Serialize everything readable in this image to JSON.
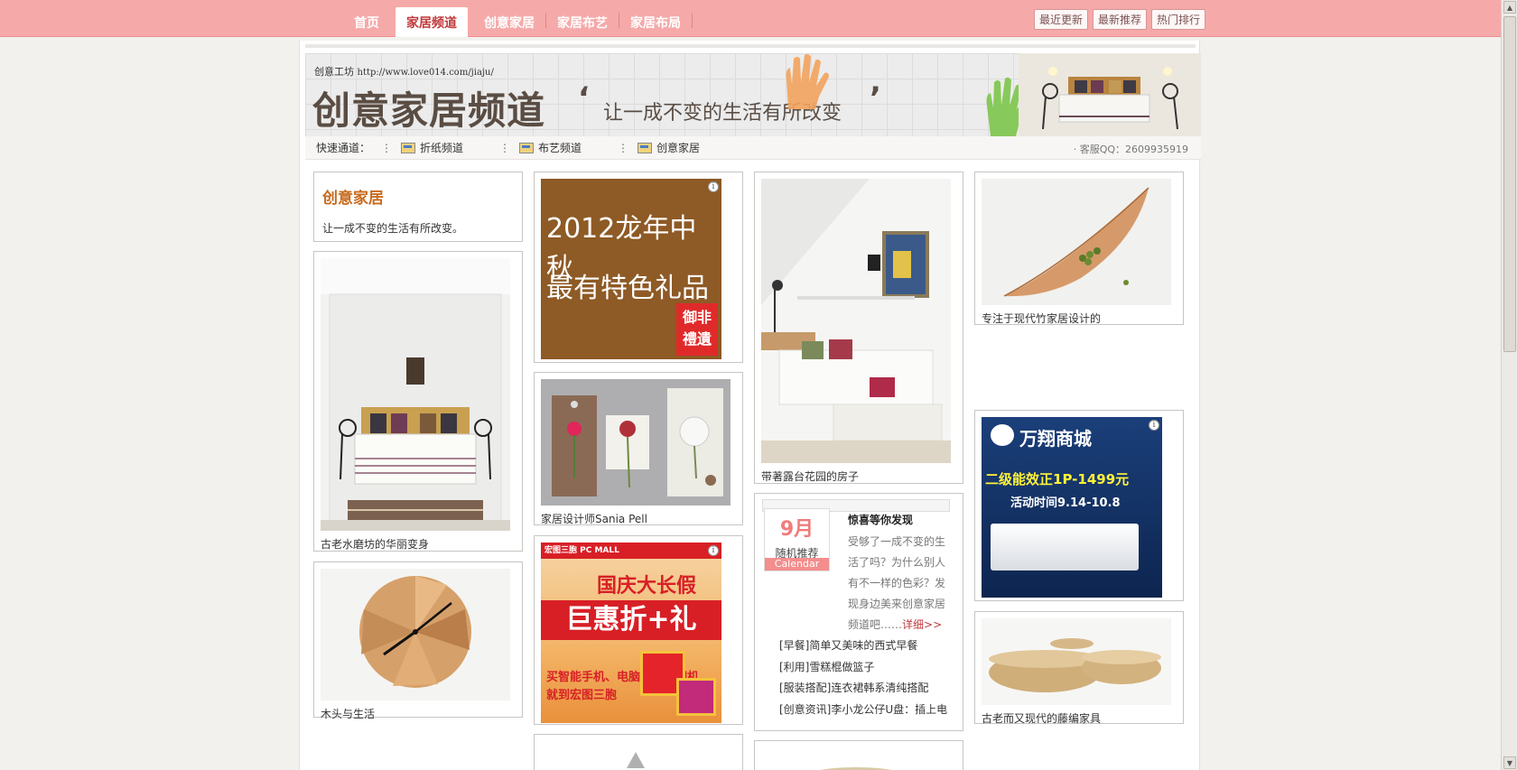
{
  "nav": {
    "items": [
      {
        "label": "首页",
        "active": false
      },
      {
        "label": "家居频道",
        "active": true
      },
      {
        "label": "创意家居",
        "active": false
      },
      {
        "label": "家居布艺",
        "active": false
      },
      {
        "label": "家居布局",
        "active": false
      }
    ],
    "right_buttons": [
      "最近更新",
      "最新推荐",
      "热门排行"
    ]
  },
  "banner": {
    "site_name": "创意工坊",
    "url": "http://www.love014.com/jiaju/",
    "title": "创意家居频道",
    "slogan": "让一成不变的生活有所改变",
    "quote_open": "‘",
    "quote_close": "’"
  },
  "quickbar": {
    "label": "快速通道：",
    "links": [
      "折纸频道",
      "布艺频道",
      "创意家居"
    ],
    "separator": "⋮",
    "qq": "· 客服QQ：2609935919"
  },
  "intro": {
    "title": "创意家居",
    "desc": "让一成不变的生活有所改变。"
  },
  "cards": {
    "bedroom": "古老水磨坊的华丽变身",
    "clock": "木头与生活",
    "ad_mooncake_line1": "2012龙年中秋",
    "ad_mooncake_line2": "最有特色礼品",
    "ad_mooncake_seal": "御非\n禮遺",
    "tags": "家居设计师Sania Pell",
    "ad_pcmall_brand": "宏图三胞 PC MALL",
    "ad_pcmall_line1": "国庆大长假",
    "ad_pcmall_line2": "巨惠折+礼",
    "ad_pcmall_line3": "买智能手机、电脑、单反相机",
    "ad_pcmall_line4": "就到宏图三胞",
    "livingroom": "带著露台花园的房子",
    "bamboo": "专注于现代竹家居设计的",
    "ad_aircon_brand": "万翔商城",
    "ad_aircon_line1": "二级能效正1P-1499元",
    "ad_aircon_line2": "活动时间9.14-10.8",
    "wicker": "古老而又现代的藤编家具",
    "info_glyph": "i"
  },
  "random": {
    "month": "9月",
    "label": "随机推荐",
    "calendar": "Calendar",
    "title": "惊喜等你发现",
    "desc": "受够了一成不变的生活了吗？为什么别人有不一样的色彩？发现身边美来创意家居频道吧……",
    "more": "详细>>",
    "list": [
      "[早餐]简单又美味的西式早餐",
      "[利用]雪糕棍做篮子",
      "[服装搭配]连衣裙韩系清纯搭配",
      "[创意资讯]李小龙公仔U盘：插上电"
    ]
  },
  "colors": {
    "nav_bg": "#f6a9a9",
    "accent": "#c0393b",
    "intro_title": "#c86b1e"
  }
}
